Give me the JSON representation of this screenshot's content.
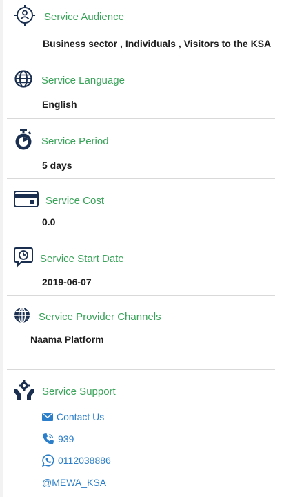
{
  "sections": [
    {
      "title": "Service Audience",
      "value": "Business sector , Individuals , Visitors to the KSA",
      "icon": "audience-icon"
    },
    {
      "title": "Service Language",
      "value": "English",
      "icon": "globe-icon"
    },
    {
      "title": "Service Period",
      "value": "5 days",
      "icon": "stopwatch-icon"
    },
    {
      "title": "Service Cost",
      "value": "0.0",
      "icon": "credit-card-icon"
    },
    {
      "title": "Service Start Date",
      "value": "2019-06-07",
      "icon": "calendar-clock-icon"
    },
    {
      "title": "Service Provider Channels",
      "value": "Naama Platform",
      "icon": "globe-channels-icon"
    }
  ],
  "support": {
    "title": "Service Support",
    "icon": "support-hands-gear-icon",
    "links": [
      {
        "label": "Contact Us",
        "icon": "envelope-icon"
      },
      {
        "label": "939",
        "icon": "phone-icon"
      },
      {
        "label": "0112038886",
        "icon": "whatsapp-icon"
      },
      {
        "label": "@MEWA_KSA",
        "icon": ""
      }
    ]
  },
  "colors": {
    "title_green": "#3aa35a",
    "link_blue": "#2b7ec9",
    "text_dark": "#1f1f1f",
    "icon_navy": "#1a2f4f"
  }
}
